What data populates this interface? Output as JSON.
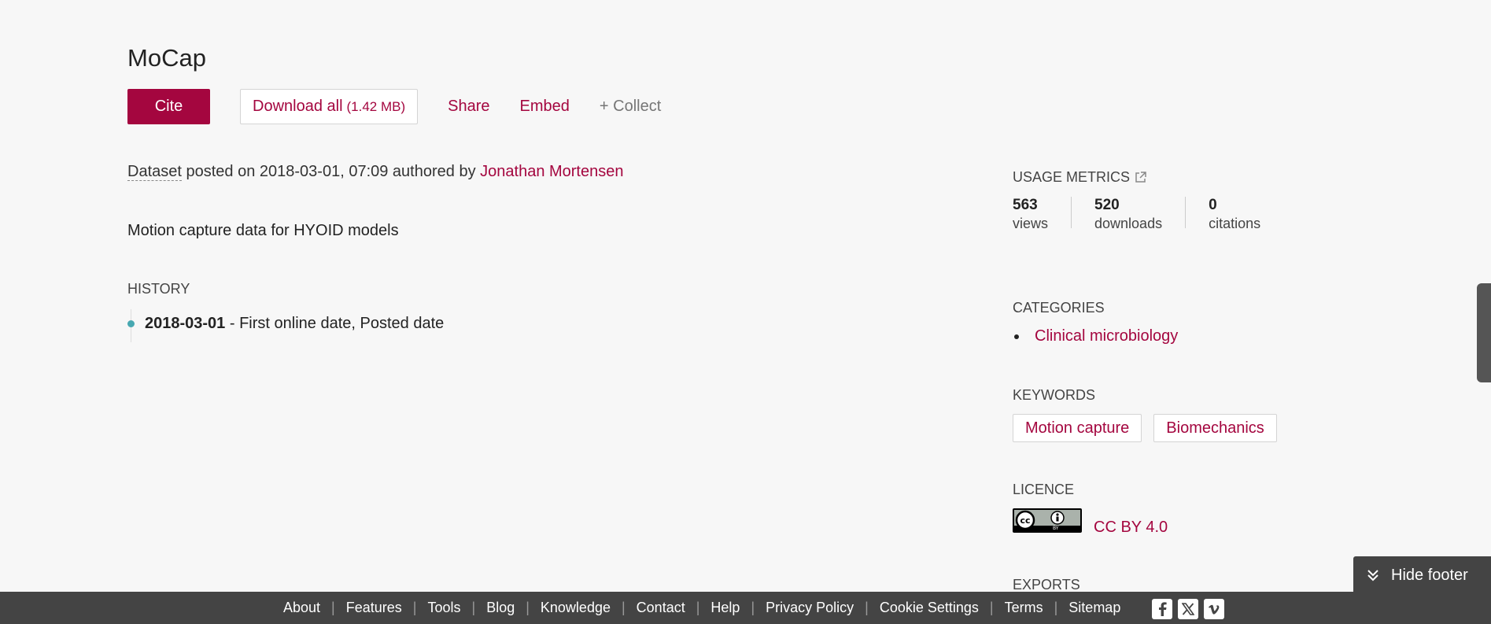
{
  "title": "MoCap",
  "actions": {
    "cite": "Cite",
    "download": "Download all",
    "download_size": "(1.42 MB)",
    "share": "Share",
    "embed": "Embed",
    "collect": "+ Collect"
  },
  "posted": {
    "type": "Dataset",
    "text": "posted on 2018-03-01, 07:09 authored by",
    "author": "Jonathan Mortensen"
  },
  "description": "Motion capture data for HYOID models",
  "history": {
    "heading": "HISTORY",
    "entries": [
      {
        "date": "2018-03-01",
        "text": " - First online date, Posted date"
      }
    ]
  },
  "usage_metrics": {
    "heading": "USAGE METRICS",
    "views": {
      "value": "563",
      "label": "views"
    },
    "downloads": {
      "value": "520",
      "label": "downloads"
    },
    "citations": {
      "value": "0",
      "label": "citations"
    }
  },
  "categories": {
    "heading": "CATEGORIES",
    "items": [
      "Clinical microbiology"
    ]
  },
  "keywords": {
    "heading": "KEYWORDS",
    "items": [
      "Motion capture",
      "Biomechanics"
    ]
  },
  "licence": {
    "heading": "LICENCE",
    "link": "CC BY 4.0",
    "badge_text": "BY"
  },
  "exports": {
    "heading": "EXPORTS"
  },
  "hide_footer": "Hide footer",
  "footer": {
    "links": [
      "About",
      "Features",
      "Tools",
      "Blog",
      "Knowledge",
      "Contact",
      "Help",
      "Privacy Policy",
      "Cookie Settings",
      "Terms",
      "Sitemap"
    ],
    "social": [
      "facebook-icon",
      "x-icon",
      "vimeo-icon"
    ]
  },
  "colors": {
    "accent": "#a4063f",
    "footer_bg": "#444444",
    "history_dot": "#47a8b1"
  }
}
